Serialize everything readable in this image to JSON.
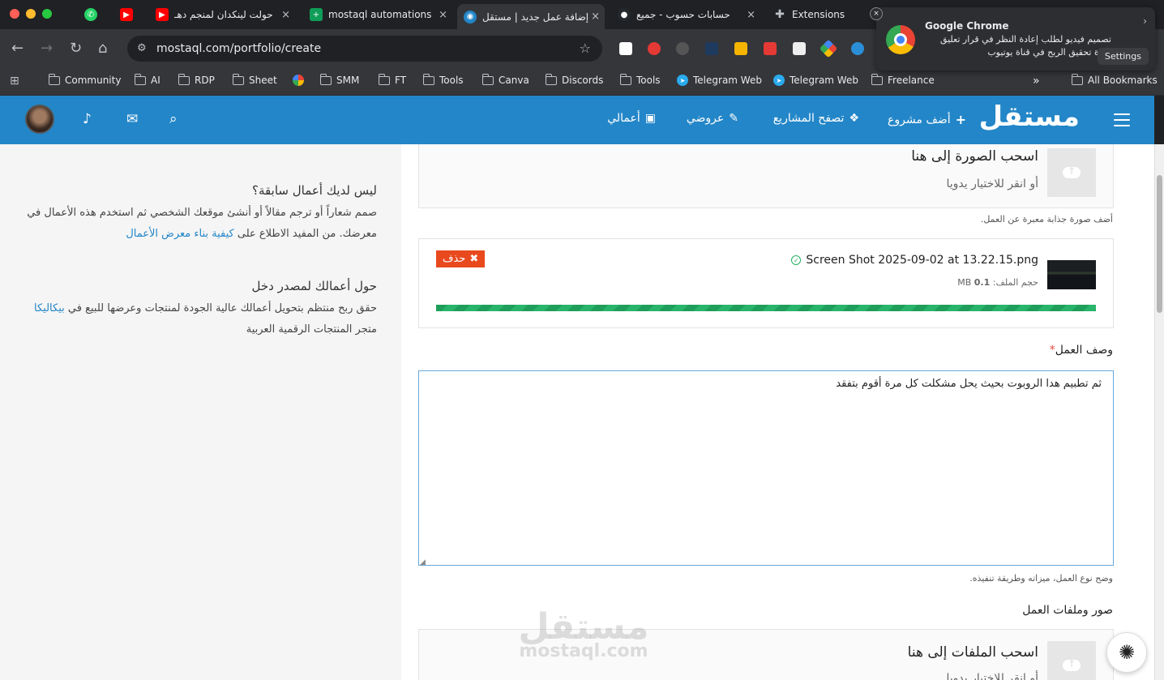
{
  "browser": {
    "tabs": [
      {
        "label": "",
        "icon": "whatsapp-icon",
        "color": "#25d366"
      },
      {
        "label": "",
        "icon": "youtube-icon",
        "color": "#ff0000"
      },
      {
        "label": "حولت لينكدان لمنجم دهـ",
        "icon": "youtube-icon",
        "color": "#ff0000"
      },
      {
        "label": "mostaql automations",
        "icon": "sheets-icon",
        "color": "#0f9d58"
      },
      {
        "label": "إضافة عمل جديد | مستقل",
        "icon": "mostaql-icon",
        "color": "#2386c8"
      },
      {
        "label": "حسابات حسوب - جميع",
        "icon": "github-icon",
        "color": "#24292e"
      },
      {
        "label": "Extensions",
        "icon": "puzzle-icon",
        "color": "#bdc1c6"
      }
    ],
    "url": "mostaql.com/portfolio/create",
    "bookmarks": [
      "Community",
      "AI",
      "RDP",
      "Sheet",
      "SMM",
      "FT",
      "Tools",
      "Canva",
      "Discords",
      "Tools",
      "Telegram Web",
      "Telegram Web",
      "Freelance"
    ],
    "all_bookmarks": "All Bookmarks",
    "more": "»"
  },
  "notification": {
    "title": "Google Chrome",
    "body": "تصميم فيديو لطلب إعادة النظر في قرار تعليق ميزة تحقيق الربح في قناة يوتيوب",
    "settings": "Settings",
    "close": "×",
    "expand": "›"
  },
  "site": {
    "logo": "مستقل",
    "nav": [
      {
        "label": "أضف مشروع",
        "icon": "plus-icon"
      },
      {
        "label": "تصفح المشاريع",
        "icon": "cubes-icon"
      },
      {
        "label": "عروضي",
        "icon": "tag-icon"
      },
      {
        "label": "أعمالي",
        "icon": "briefcase-icon"
      }
    ]
  },
  "sidebar": {
    "blocks": [
      {
        "title": "ليس لديك أعمال سابقة؟",
        "text": "صمم شعاراً أو ترجم مقالاً أو أنشئ موقعك الشخصي ثم استخدم هذه الأعمال في معرضك. من المفيد الاطلاع على",
        "link": "كيفية بناء معرض الأعمال"
      },
      {
        "title": "حول أعمالك لمصدر دخل",
        "text": "حقق ربح منتظم بتحويل أعمالك عالية الجودة لمنتجات وعرضها للبيع في",
        "link": "بيكاليكا",
        "text_after": "متجر المنتجات الرقمية العربية"
      }
    ]
  },
  "form": {
    "image_drop": {
      "title": "اسحب الصورة إلى هنا",
      "subtitle": "أو انقر للاختيار يدويا",
      "hint": "أضف صورة جذابة معبرة عن العمل."
    },
    "uploaded_file": {
      "name": "Screen Shot 2025-09-02 at 13.22.15.png",
      "size_label": "حجم الملف:",
      "size_value": "0.1",
      "size_unit": "MB",
      "delete_label": "حذف",
      "progress": 1.0
    },
    "description": {
      "label": "وصف العمل",
      "required_mark": "*",
      "value": "ثم تطبيم هدا الروبوت بحيث يحل مشكلت كل مرة أقوم بتفقد",
      "hint": "وضح نوع العمل، ميزاته وطريقة تنفيذه."
    },
    "files": {
      "label": "صور وملفات العمل",
      "title": "اسحب الملفات إلى هنا",
      "subtitle": "أو انقر للاختيار يدويا"
    }
  },
  "watermark": {
    "line1": "مستقل",
    "line2": "mostaql.com"
  }
}
